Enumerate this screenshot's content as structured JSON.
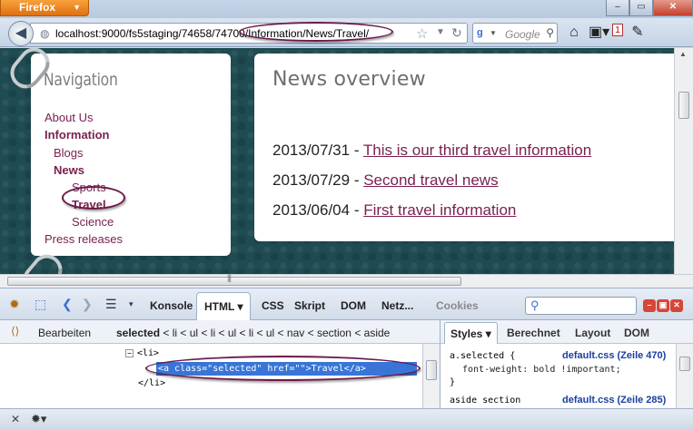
{
  "browser": {
    "app_button": "Firefox",
    "url_prefix": "localhost:9000/fs5staging/74658/74700",
    "url_path": "/Information/News/Travel/",
    "search_placeholder": "Google",
    "notification_count": "1"
  },
  "navigation": {
    "title": "Navigation",
    "items": [
      {
        "label": "About Us",
        "level": 1,
        "bold": false
      },
      {
        "label": "Information",
        "level": 1,
        "bold": true
      },
      {
        "label": "Blogs",
        "level": 2,
        "bold": false
      },
      {
        "label": "News",
        "level": 2,
        "bold": true
      },
      {
        "label": "Sports",
        "level": 3,
        "bold": false
      },
      {
        "label": "Travel",
        "level": 3,
        "bold": true
      },
      {
        "label": "Science",
        "level": 3,
        "bold": false
      },
      {
        "label": "Press releases",
        "level": 1,
        "bold": false
      }
    ]
  },
  "news": {
    "title": "News overview",
    "items": [
      {
        "date": "2013/07/31",
        "sep": " - ",
        "title": "This is our third travel information"
      },
      {
        "date": "2013/07/29",
        "sep": " - ",
        "title": "Second travel news"
      },
      {
        "date": "2013/06/04",
        "sep": " - ",
        "title": "First travel information"
      }
    ]
  },
  "firebug": {
    "tabs": [
      "Konsole",
      "HTML",
      "CSS",
      "Skript",
      "DOM",
      "Netz...",
      "Cookies"
    ],
    "active_tab": "HTML",
    "edit_label": "Bearbeiten",
    "breadcrumb": [
      "selected",
      "li",
      "ul",
      "li",
      "ul",
      "li",
      "ul",
      "nav",
      "section",
      "aside"
    ],
    "html_lines": {
      "li_open": "<li>",
      "selected": "<a class=\"selected\" href=\"\">Travel</a>",
      "li_close": "</li>"
    },
    "side_tabs": [
      "Styles",
      "Berechnet",
      "Layout",
      "DOM"
    ],
    "styles": {
      "rule1_selector": "a.selected {",
      "rule1_source": "default.css (Zeile 470)",
      "rule1_decl": "font-weight: bold !important;",
      "rule1_close": "}",
      "rule2_selector": "aside section",
      "rule2_source": "default.css (Zeile 285)"
    }
  },
  "colors": {
    "link": "#7a2150",
    "page_bg": "#1f4b52",
    "selection": "#3875d7",
    "annotation_oval": "#6b1a4a"
  }
}
